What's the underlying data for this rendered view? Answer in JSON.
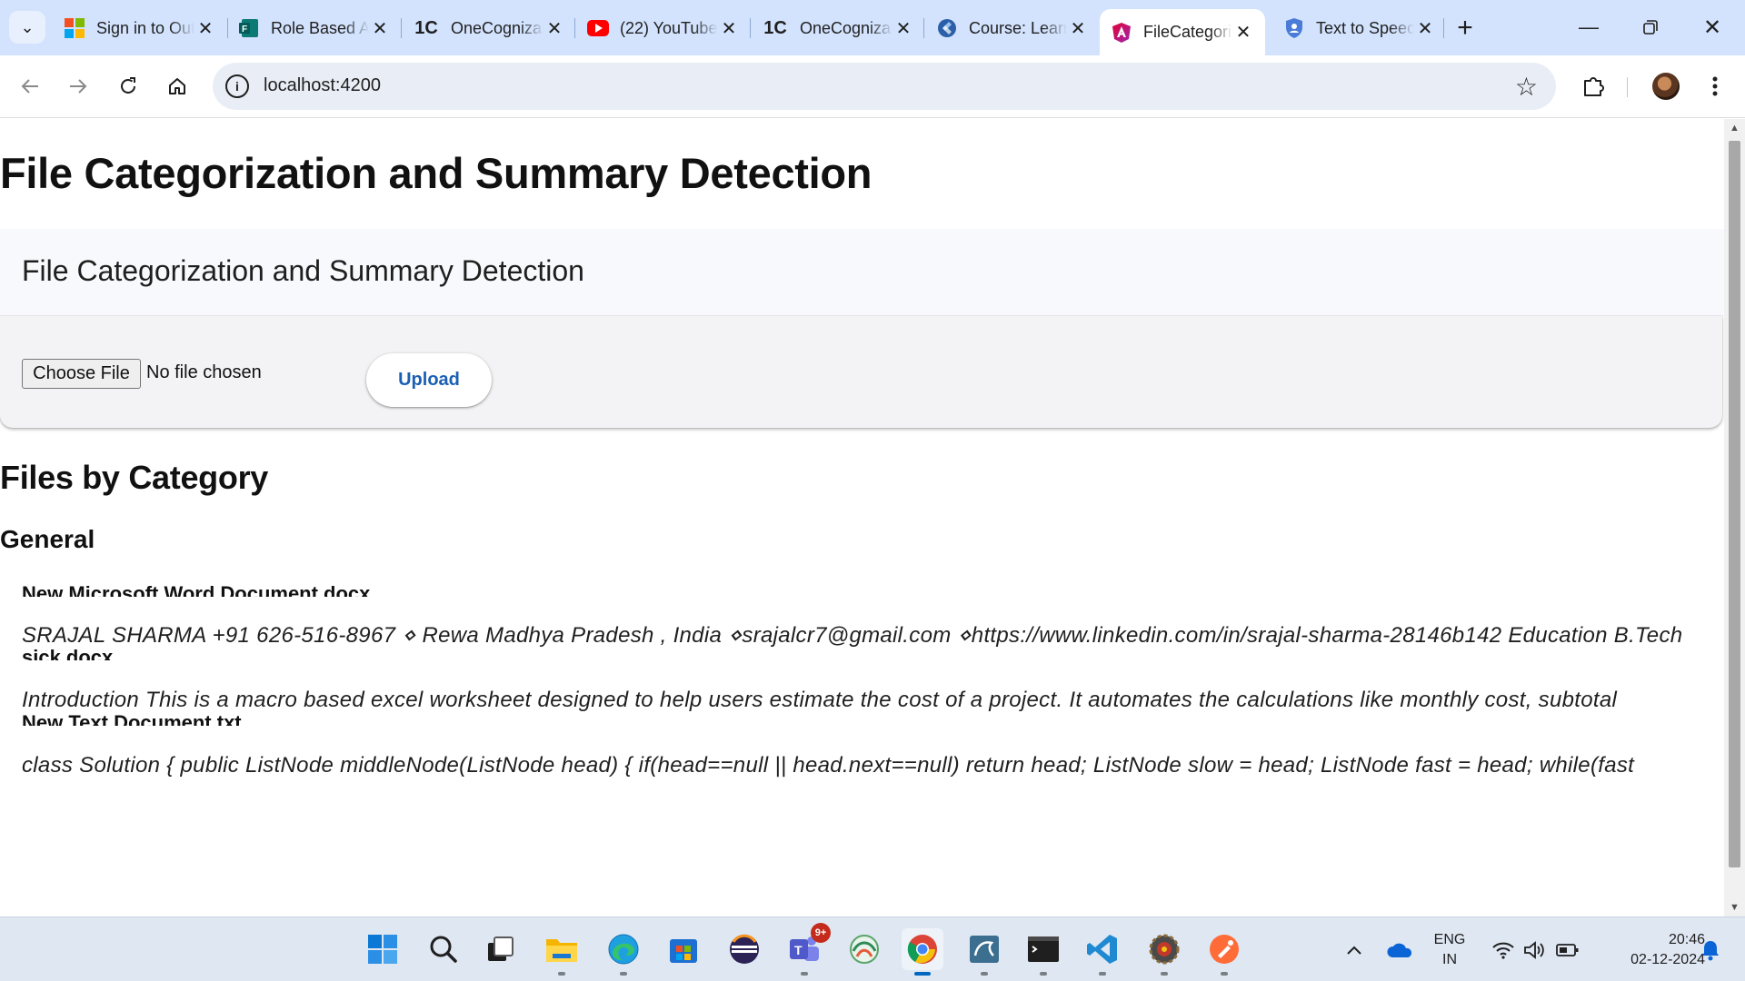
{
  "browser": {
    "tabs": [
      {
        "title": "Sign in to Outlook",
        "favicon": "microsoft-icon"
      },
      {
        "title": "Role Based Access",
        "favicon": "forms-icon"
      },
      {
        "title": "OneCognizant",
        "favicon": "onecognizant-icon"
      },
      {
        "title": "(22) YouTube",
        "favicon": "youtube-icon"
      },
      {
        "title": "OneCognizant",
        "favicon": "onecognizant-icon"
      },
      {
        "title": "Course: Learning",
        "favicon": "course-icon"
      },
      {
        "title": "FileCategorization",
        "favicon": "angular-icon",
        "active": true
      },
      {
        "title": "Text to Speech",
        "favicon": "shield-icon"
      }
    ],
    "url": "localhost:4200"
  },
  "page": {
    "main_heading": "File Categorization and Summary Detection",
    "card_title": "File Categorization and Summary Detection",
    "choose_file_label": "Choose File",
    "no_file_label": "No file chosen",
    "upload_label": "Upload",
    "section_heading": "Files by Category",
    "categories": [
      {
        "name": "General",
        "files": [
          {
            "name": "New Microsoft Word Document.docx",
            "summary": "SRAJAL SHARMA +91 626-516-8967 ⋄ Rewa Madhya Pradesh , India ⋄srajalcr7@gmail.com ⋄https://www.linkedin.com/in/srajal-sharma-28146b142 Education B.Tech"
          },
          {
            "name": "sick.docx",
            "summary": "Introduction This is a macro based excel worksheet designed to help users estimate the cost of a project. It automates the calculations like monthly cost, subtotal"
          },
          {
            "name": "New Text Document.txt",
            "summary": "class Solution { public ListNode middleNode(ListNode head) { if(head==null || head.next==null) return head; ListNode slow = head; ListNode fast = head; while(fast"
          }
        ]
      }
    ]
  },
  "taskbar": {
    "apps": [
      "start-icon",
      "search-icon",
      "task-view-icon",
      "file-explorer-icon",
      "edge-icon",
      "store-icon",
      "eclipse-icon",
      "teams-icon",
      "vpn-icon",
      "chrome-icon",
      "mysql-workbench-icon",
      "terminal-icon",
      "vscode-icon",
      "gear-app-icon",
      "postman-icon"
    ],
    "teams_badge": "9+",
    "lang_line1": "ENG",
    "lang_line2": "IN",
    "time": "20:46",
    "date": "02-12-2024"
  },
  "colors": {
    "tabstrip_bg": "#d3e3fd",
    "omnibox_bg": "#e9eef6",
    "upload_text": "#1a5fb4",
    "taskbar_bg": "#dfe7f2"
  }
}
